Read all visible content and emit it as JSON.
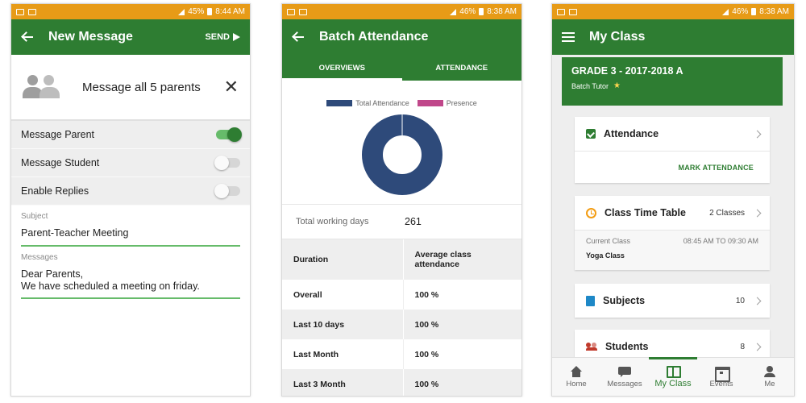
{
  "colors": {
    "status_bar": "#e79b17",
    "primary_green": "#2e7d32",
    "toggle_on": "#2e7d32",
    "chart_total": "#2e4a7a",
    "chart_presence": "#c0478a"
  },
  "screen1": {
    "status": {
      "battery": "45%",
      "time": "8:44 AM"
    },
    "appbar": {
      "title": "New Message",
      "action": "SEND"
    },
    "recipient": {
      "text": "Message all 5 parents"
    },
    "toggles": [
      {
        "label": "Message Parent",
        "on": true
      },
      {
        "label": "Message Student",
        "on": false
      },
      {
        "label": "Enable Replies",
        "on": false
      }
    ],
    "subject": {
      "label": "Subject",
      "value": "Parent-Teacher Meeting"
    },
    "messages": {
      "label": "Messages",
      "line1": "Dear Parents,",
      "line2": "We have scheduled a meeting on friday."
    }
  },
  "screen2": {
    "status": {
      "battery": "46%",
      "time": "8:38 AM"
    },
    "appbar": {
      "title": "Batch Attendance"
    },
    "tabs": [
      "OVERVIEWS",
      "ATTENDANCE"
    ],
    "legend": [
      "Total Attendance",
      "Presence"
    ],
    "working_days": {
      "label": "Total working days",
      "value": "261"
    },
    "table": {
      "headers": [
        "Duration",
        "Average class attendance"
      ],
      "rows": [
        {
          "duration": "Overall",
          "value": "100 %"
        },
        {
          "duration": "Last 10 days",
          "value": "100 %"
        },
        {
          "duration": "Last Month",
          "value": "100 %"
        },
        {
          "duration": "Last 3 Month",
          "value": "100 %"
        }
      ]
    }
  },
  "screen3": {
    "status": {
      "battery": "46%",
      "time": "8:38 AM"
    },
    "appbar": {
      "title": "My Class"
    },
    "grade": {
      "title": "GRADE 3 - 2017-2018 A",
      "subtitle": "Batch Tutor"
    },
    "attendance": {
      "label": "Attendance",
      "action": "MARK ATTENDANCE"
    },
    "timetable": {
      "label": "Class Time Table",
      "count": "2 Classes",
      "current_label": "Current Class",
      "time": "08:45 AM TO 09:30 AM",
      "class_name": "Yoga Class"
    },
    "subjects": {
      "label": "Subjects",
      "count": "10"
    },
    "students": {
      "label": "Students",
      "count": "8"
    },
    "nav": [
      "Home",
      "Messages",
      "My Class",
      "Events",
      "Me"
    ]
  }
}
